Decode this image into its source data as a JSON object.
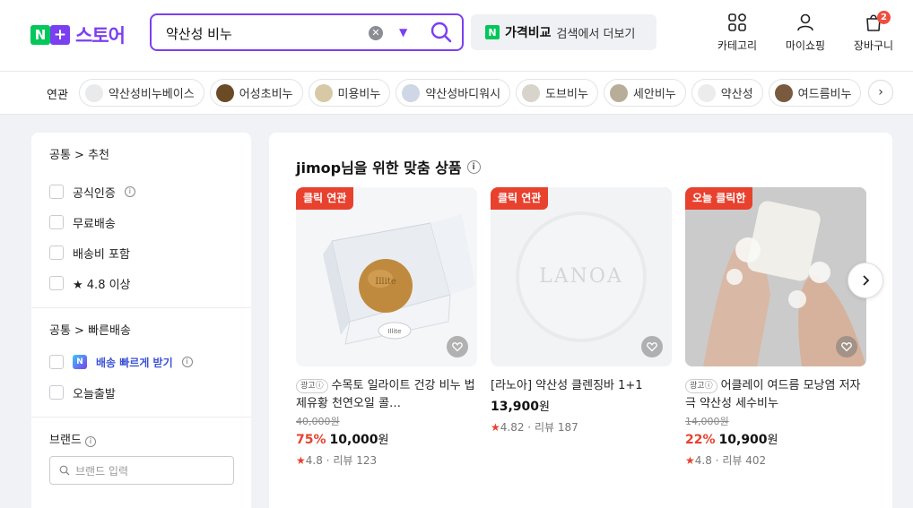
{
  "header": {
    "logo_n": "N",
    "logo_plus": "+",
    "logo_text": "스토어",
    "search": {
      "value": "약산성 비누",
      "clear_label": "✕",
      "dropdown_label": "▼"
    },
    "compare": {
      "n": "N",
      "strong": "가격비교",
      "text": "검색에서 더보기"
    },
    "icons": {
      "category": "카테고리",
      "myshopping": "마이쇼핑",
      "cart": "장바구니",
      "cart_count": "2"
    }
  },
  "related": {
    "label": "연관",
    "chips": [
      {
        "label": "약산성비누베이스",
        "thumb_color": "#e9eaec"
      },
      {
        "label": "어성초비누",
        "thumb_color": "#6b4a26"
      },
      {
        "label": "미용비누",
        "thumb_color": "#d8c9a6"
      },
      {
        "label": "약산성바디워시",
        "thumb_color": "#cfd6e6"
      },
      {
        "label": "도브비누",
        "thumb_color": "#d9d4cb"
      },
      {
        "label": "세안비누",
        "thumb_color": "#b7ad99"
      },
      {
        "label": "약산성",
        "thumb_color": "#ececec"
      },
      {
        "label": "여드름비누",
        "thumb_color": "#7a5a3e"
      }
    ],
    "next_label": "›"
  },
  "filters": {
    "section1": {
      "head": "공통 > 추천",
      "items": [
        "공식인증",
        "무료배송",
        "배송비 포함",
        "★ 4.8 이상"
      ]
    },
    "section2": {
      "head": "공통 > 빠른배송",
      "items": [
        "배송 빠르게 받기",
        "오늘출발"
      ],
      "fast_badge": "N"
    },
    "brand": {
      "head": "브랜드",
      "placeholder": "브랜드 입력"
    },
    "info_label": "i"
  },
  "recommendation": {
    "title": "jimop님을 위한 맞춤 상품",
    "ad_label": "광고",
    "cards": [
      {
        "tag": "클릭 연관",
        "ad": true,
        "name": "수목토 일라이트 건강 비누 법제유황 천연오일 콜…",
        "original_price": "40,000원",
        "discount": "75%",
        "price": "10,000",
        "currency": "원",
        "rating": "4.8",
        "reviews": "리뷰 123"
      },
      {
        "tag": "클릭 연관",
        "ad": false,
        "name": "[라노아] 약산성 클렌징바 1+1",
        "original_price": "",
        "discount": "",
        "price": "13,900",
        "currency": "원",
        "rating": "4.82",
        "reviews": "리뷰 187"
      },
      {
        "tag": "오늘 클릭한",
        "ad": true,
        "name": "어클레이 여드름 모낭염 저자극 약산성 세수비누",
        "original_price": "14,000원",
        "discount": "22%",
        "price": "10,900",
        "currency": "원",
        "rating": "4.8",
        "reviews": "리뷰 402"
      }
    ],
    "product_image_text": {
      "card0": "Illite",
      "card1": "LANOA"
    }
  },
  "colors": {
    "brand_purple": "#7b3ff2",
    "naver_green": "#03c75a",
    "accent_red": "#e8412e"
  }
}
